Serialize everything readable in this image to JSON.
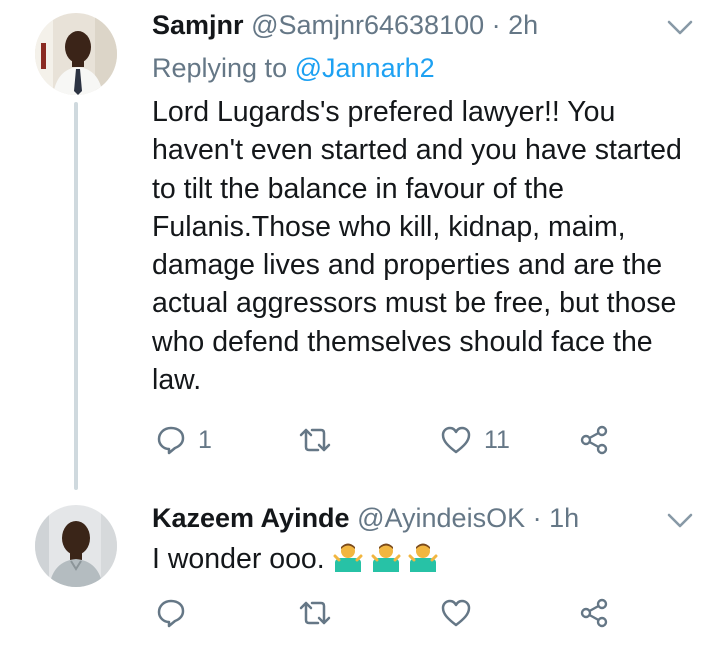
{
  "tweets": [
    {
      "name": "Samjnr",
      "handle": "@Samjnr64638100",
      "separator": "·",
      "time": "2h",
      "replying_prefix": "Replying to",
      "replying_to": "@Jannarh2",
      "text": "Lord Lugards's prefered lawyer!! You haven't even started and you have started to tilt the balance in favour of the Fulanis.Those who kill, kidnap, maim, damage lives and properties and are the actual aggressors must be free, but those who defend themselves should face the law.",
      "reply_count": "1",
      "retweet_count": "",
      "like_count": "11"
    },
    {
      "name": "Kazeem Ayinde",
      "handle": "@AyindeisOK",
      "separator": "·",
      "time": "1h",
      "text": "I wonder ooo.",
      "emoji": [
        "man-shrugging",
        "man-shrugging",
        "man-shrugging"
      ],
      "reply_count": "",
      "retweet_count": "",
      "like_count": ""
    }
  ],
  "colors": {
    "name": "#14171a",
    "meta": "#657786",
    "mention": "#1da1f2",
    "thread_line": "#cfd9de",
    "emoji_shirt": "#27c2a6",
    "emoji_skin": "#f2b640"
  },
  "icons": [
    "reply-icon",
    "retweet-icon",
    "like-icon",
    "share-icon",
    "chevron-down-icon"
  ]
}
